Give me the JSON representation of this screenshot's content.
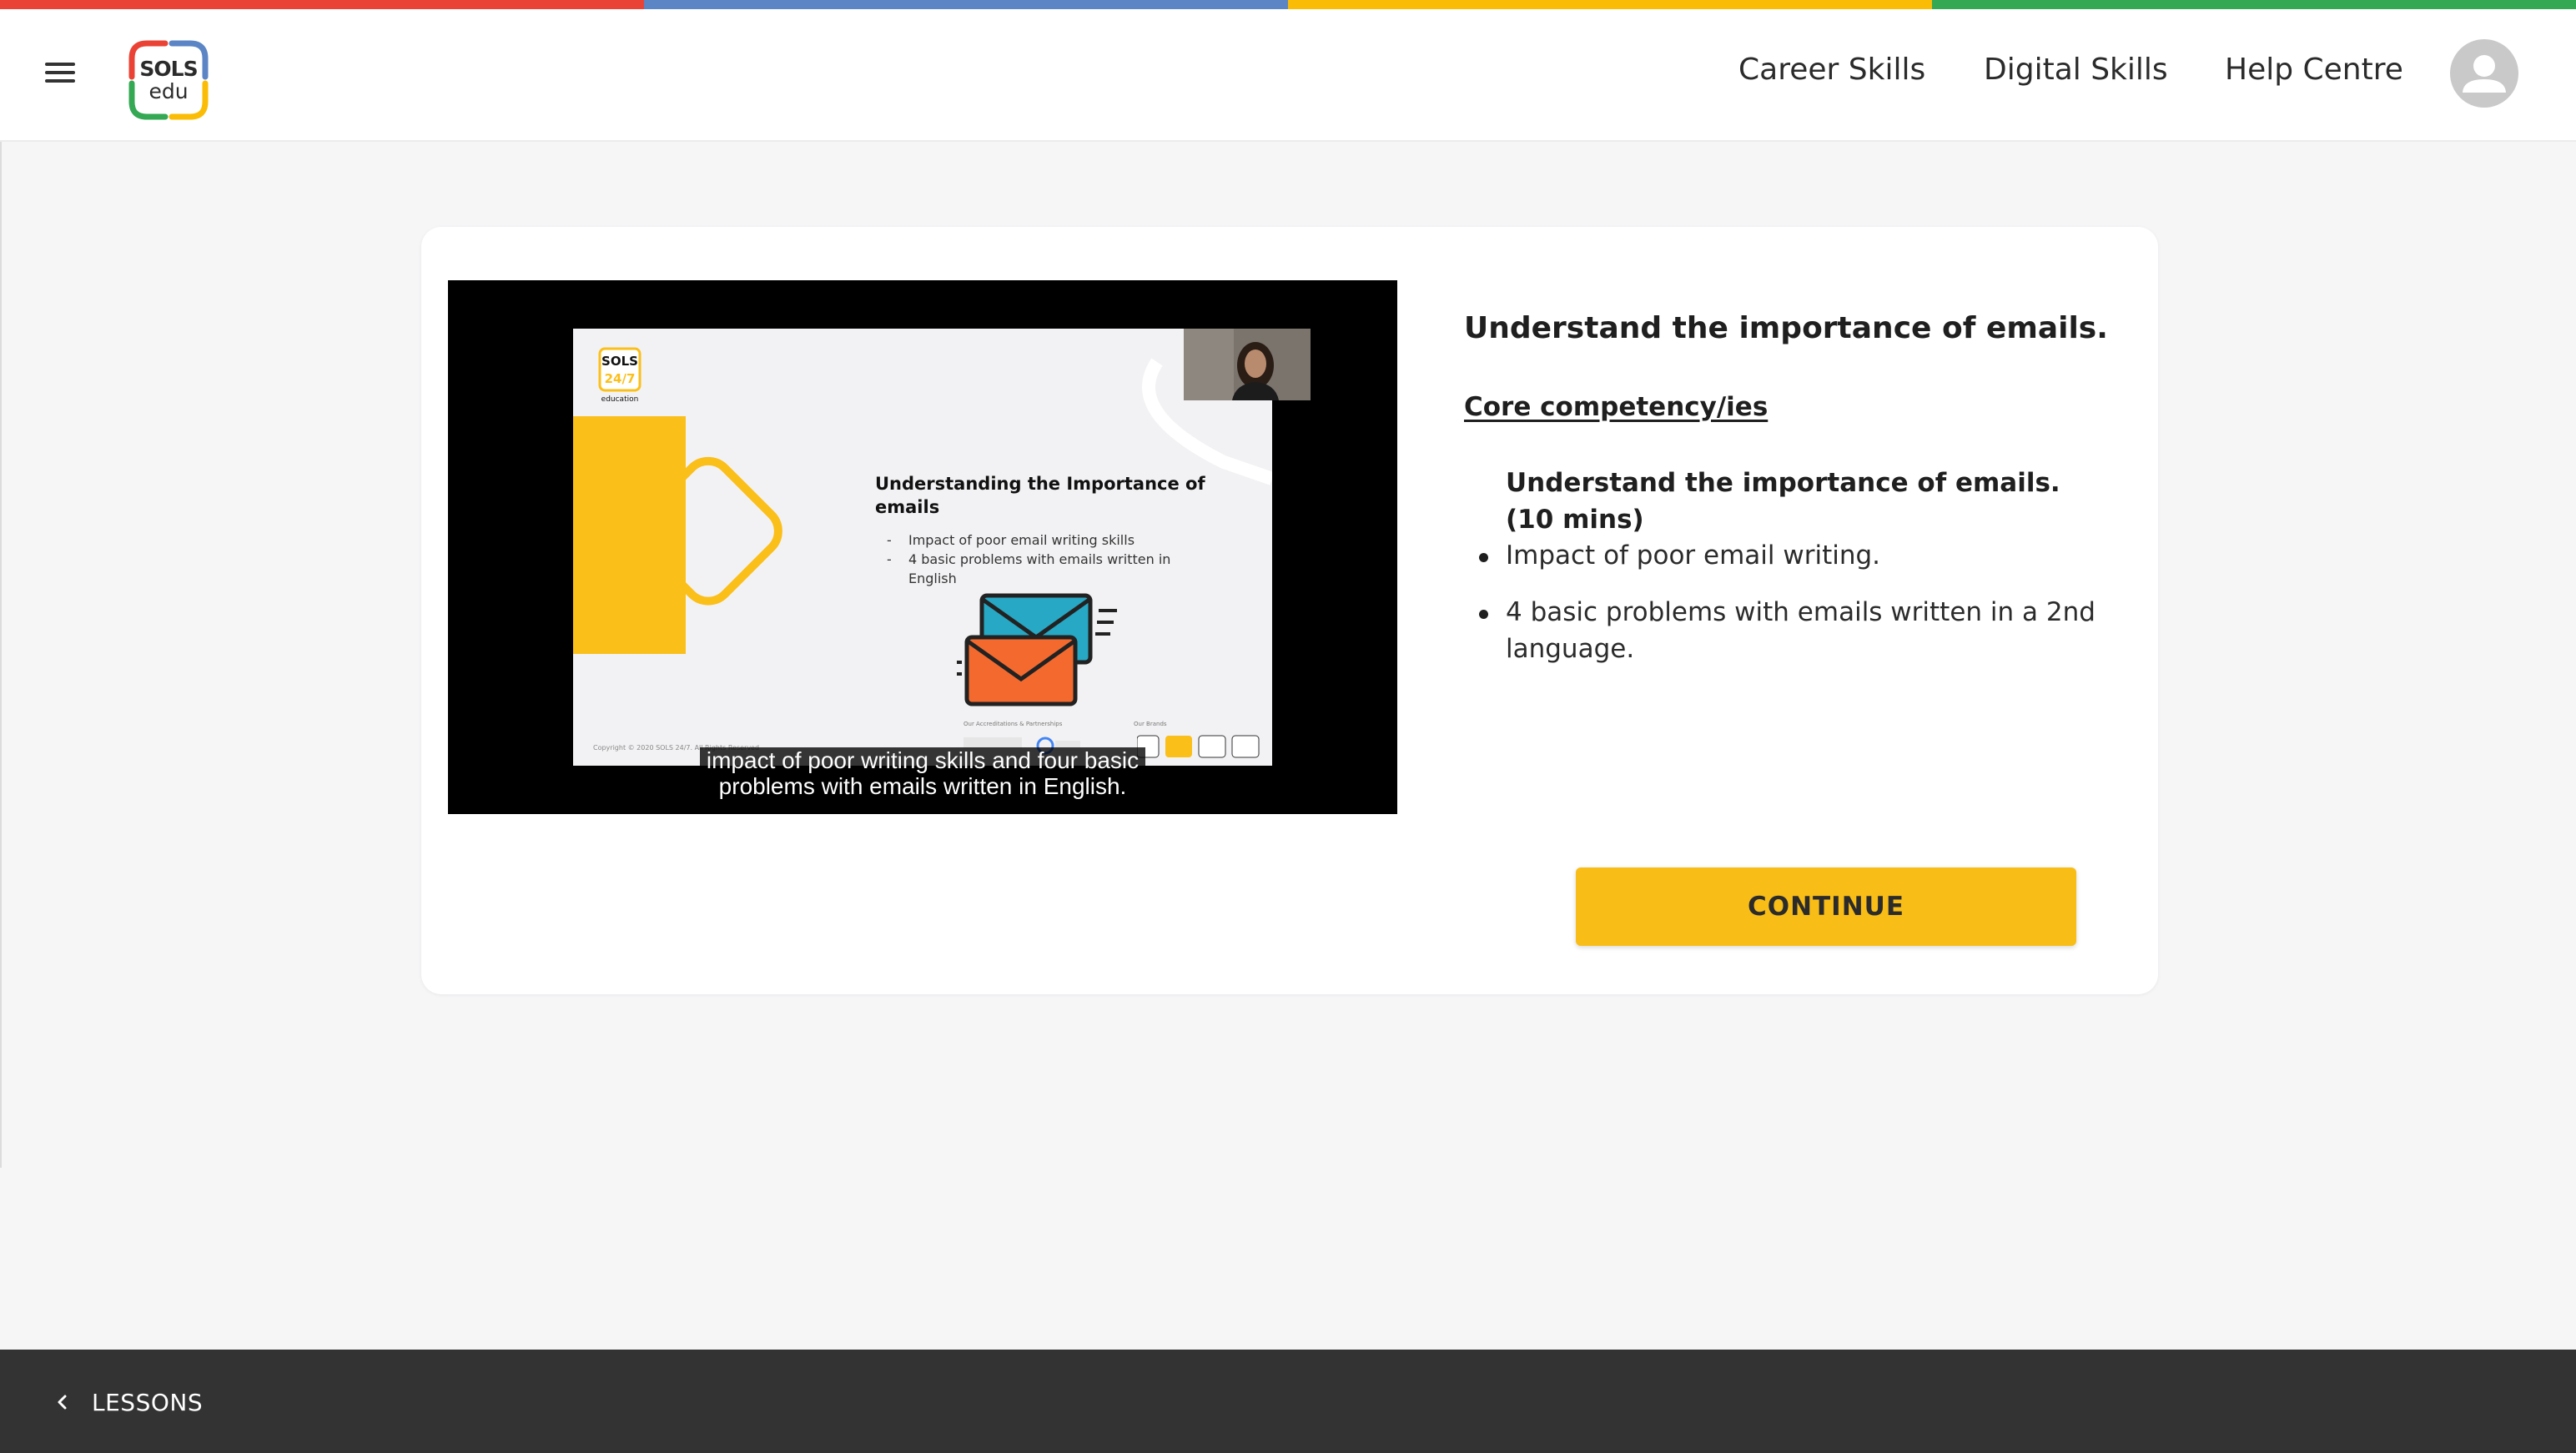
{
  "theme": {
    "strip_colors": [
      "#ea4335",
      "#5c85c5",
      "#fbbc05",
      "#34a853"
    ],
    "accent": "#f8bd16",
    "footer_bg": "#333333"
  },
  "header": {
    "logo": {
      "line1": "SOLS",
      "line2": "edu"
    },
    "nav": [
      {
        "label": "Career Skills"
      },
      {
        "label": "Digital Skills"
      },
      {
        "label": "Help Centre"
      }
    ],
    "menu_icon": "hamburger-menu-icon",
    "avatar_icon": "user-avatar-icon"
  },
  "video": {
    "slide": {
      "logo_line1": "SOLS",
      "logo_line2": "24/7",
      "logo_line3": "education",
      "title": "Understanding the Importance of emails",
      "bullets": [
        "Impact of poor email writing skills",
        "4 basic problems with emails written in English"
      ],
      "copyright": "Copyright © 2020 SOLS 24/7. All Rights Reserved",
      "partners_label": "Our Accreditations & Partnerships",
      "brands_label": "Our Brands"
    },
    "caption_line1": "impact of poor writing skills and four basic",
    "caption_line2": "problems with emails written in English."
  },
  "lesson": {
    "title": "Understand the importance of emails.",
    "core_heading": "Core competency/ies",
    "competency_title": "Understand the importance of emails. (10 mins)",
    "bullets": [
      "Impact of poor email writing.",
      "4 basic problems with emails written in a 2nd language."
    ],
    "continue_label": "CONTINUE"
  },
  "footer": {
    "lessons_label": "LESSONS",
    "back_icon": "chevron-left-icon"
  }
}
